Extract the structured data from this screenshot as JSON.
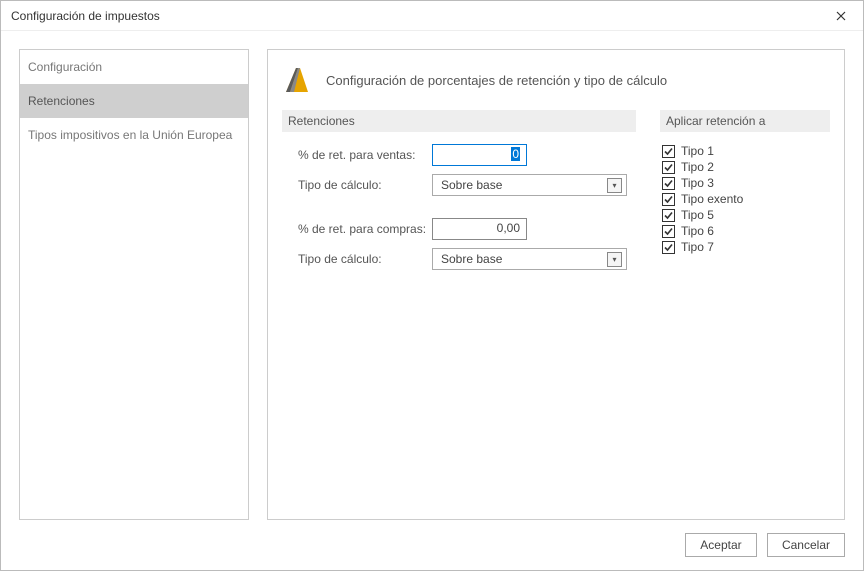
{
  "window": {
    "title": "Configuración de impuestos"
  },
  "sidebar": {
    "items": [
      {
        "label": "Configuración",
        "selected": false
      },
      {
        "label": "Retenciones",
        "selected": true
      },
      {
        "label": "Tipos impositivos en la Unión Europea",
        "selected": false
      }
    ]
  },
  "header": {
    "title": "Configuración de porcentajes de retención y tipo de cálculo"
  },
  "section_left": {
    "title": "Retenciones"
  },
  "section_right": {
    "title": "Aplicar retención a"
  },
  "form": {
    "ventas_pct_label": "% de ret. para ventas:",
    "ventas_pct_value": "0",
    "ventas_tipo_label": "Tipo de cálculo:",
    "ventas_tipo_value": "Sobre base",
    "compras_pct_label": "% de ret. para compras:",
    "compras_pct_value": "0,00",
    "compras_tipo_label": "Tipo de cálculo:",
    "compras_tipo_value": "Sobre base"
  },
  "apply_to": [
    {
      "label": "Tipo 1",
      "checked": true
    },
    {
      "label": "Tipo 2",
      "checked": true
    },
    {
      "label": "Tipo 3",
      "checked": true
    },
    {
      "label": "Tipo exento",
      "checked": true
    },
    {
      "label": "Tipo 5",
      "checked": true
    },
    {
      "label": "Tipo 6",
      "checked": true
    },
    {
      "label": "Tipo 7",
      "checked": true
    }
  ],
  "buttons": {
    "accept": "Aceptar",
    "cancel": "Cancelar"
  }
}
